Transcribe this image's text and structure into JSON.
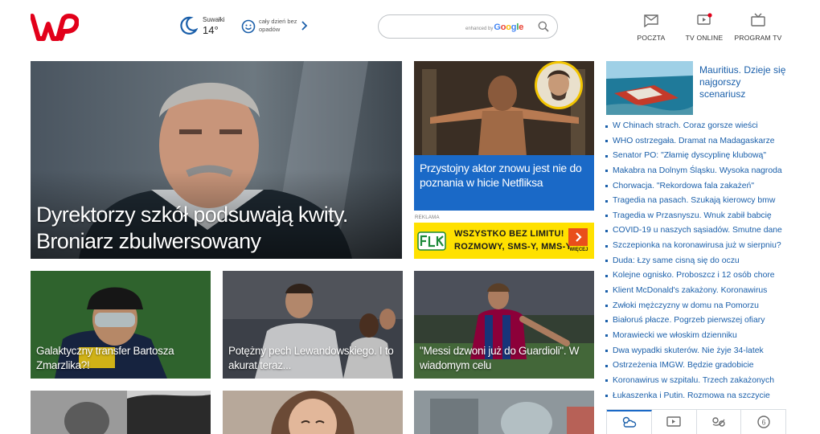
{
  "header": {
    "weather": {
      "city": "Suwałki",
      "temp": "14°",
      "forecast": "cały dzień bez opadów"
    },
    "search": {
      "placeholder": "",
      "enhanced_by": "enhanced by",
      "brand": "Google"
    },
    "nav": [
      {
        "label": "POCZTA",
        "icon": "mail-icon"
      },
      {
        "label": "TV ONLINE",
        "icon": "tv-online-icon"
      },
      {
        "label": "PROGRAM TV",
        "icon": "tv-program-icon"
      }
    ]
  },
  "main_story": {
    "title": "Dyrektorzy szkół podsuwają kwity. Broniarz zbulwersowany"
  },
  "promo_story": {
    "title": "Przystojny aktor znowu jest nie do poznania w hicie Netfliksa"
  },
  "ad": {
    "label": "REKLAMA",
    "line1": "WSZYSTKO BEZ LIMITU!",
    "line2": "ROZMOWY, SMS-Y, MMS-Y",
    "more": "WIĘCEJ"
  },
  "stories": [
    {
      "title": "Galaktyczny transfer Bartosza Zmarzlika?!"
    },
    {
      "title": "Potężny pech Lewandowskiego. I to akurat teraz..."
    },
    {
      "title": "\"Messi dzwoni już do Guardioli\". W wiadomym celu"
    }
  ],
  "sidebar": {
    "featured": {
      "title": "Mauritius. Dzieje się najgorszy scenariusz"
    },
    "headlines": [
      "W Chinach strach. Coraz gorsze wieści",
      "WHO ostrzegała. Dramat na Madagaskarze",
      "Senator PO: \"Złamię dyscyplinę klubową\"",
      "Makabra na Dolnym Śląsku. Wysoka nagroda",
      "Chorwacja. \"Rekordowa fala zakażeń\"",
      "Tragedia na pasach. Szukają kierowcy bmw",
      "Tragedia w Przasnyszu. Wnuk zabił babcię",
      "COVID-19 u naszych sąsiadów. Smutne dane",
      "Szczepionka na koronawirusa już w sierpniu?",
      "Duda: Łzy same cisną się do oczu",
      "Kolejne ognisko. Proboszcz i 12 osób chore",
      "Klient McDonald's zakażony. Koronawirus",
      "Zwłoki mężczyzny w domu na Pomorzu",
      "Białoruś płacze. Pogrzeb pierwszej ofiary",
      "Morawiecki we włoskim dzienniku",
      "Dwa wypadki skuterów. Nie żyje 34-latek",
      "Ostrzeżenia IMGW. Będzie gradobicie",
      "Koronawirus w szpitalu. Trzech zakażonych",
      "Łukaszenka i Putin. Rozmowa na szczycie"
    ],
    "tools": [
      {
        "icon": "weather-icon"
      },
      {
        "icon": "tv-icon"
      },
      {
        "icon": "horoscope-icon"
      },
      {
        "icon": "lotto-icon",
        "label": "6"
      }
    ]
  },
  "colors": {
    "brand": "#e2001a",
    "link": "#1a5faa",
    "promo_blue": "#1a69c7",
    "ad_yellow": "#ffe100",
    "ad_orange": "#e94e1b"
  }
}
